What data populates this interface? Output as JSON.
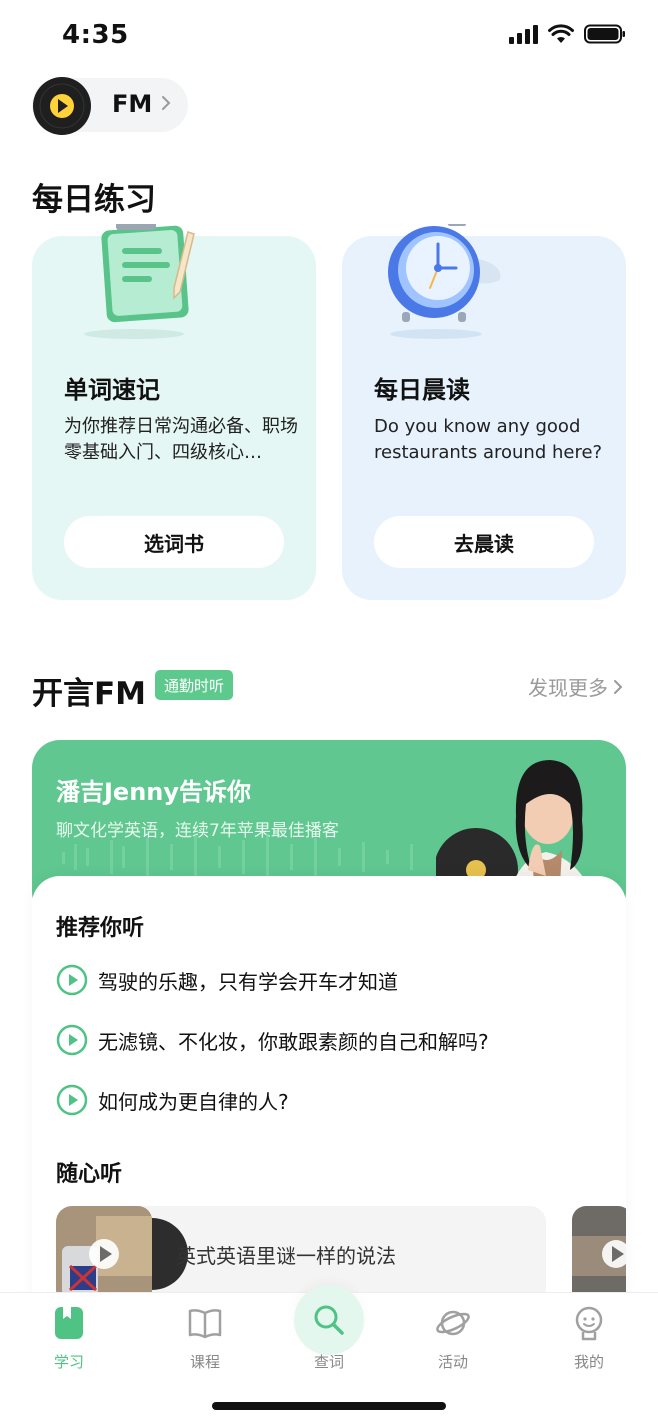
{
  "status_bar": {
    "time": "4:35"
  },
  "fm_entry": {
    "label": "FM"
  },
  "daily_practice": {
    "title": "每日练习",
    "cards": [
      {
        "title": "单词速记",
        "desc": "为你推荐日常沟通必备、职场零基础入门、四级核心…",
        "button": "选词书"
      },
      {
        "title": "每日晨读",
        "desc": "Do you know any good restaurants around here?",
        "button": "去晨读"
      }
    ]
  },
  "fm_section": {
    "title": "开言FM",
    "tag": "通勤时听",
    "more": "发现更多",
    "banner": {
      "title": "潘吉Jenny告诉你",
      "subtitle": "聊文化学英语，连续7年苹果最佳播客"
    },
    "recommend": {
      "title": "推荐你听",
      "items": [
        "驾驶的乐趣，只有学会开车才知道",
        "无滤镜、不化妆，你敢跟素颜的自己和解吗?",
        "如何成为更自律的人?"
      ]
    },
    "casual": {
      "title": "随心听",
      "episode": "英式英语里谜一样的说法"
    }
  },
  "tab_bar": {
    "items": [
      {
        "label": "学习",
        "active": true
      },
      {
        "label": "课程"
      },
      {
        "label": "查词"
      },
      {
        "label": "活动"
      },
      {
        "label": "我的"
      }
    ]
  },
  "colors": {
    "accent": "#4fc384",
    "banner": "#5fc78f",
    "card_green": "#e5f7f4",
    "card_blue": "#e7f2fc"
  }
}
